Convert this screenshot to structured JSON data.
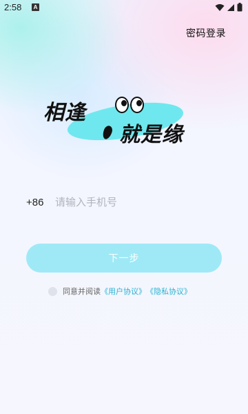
{
  "status_bar": {
    "time": "2:58",
    "notification_letter": "A",
    "icons": [
      "wifi-icon",
      "signal-icon",
      "battery-icon"
    ]
  },
  "header": {
    "password_login": "密码登录"
  },
  "logo": {
    "line1": "相逢",
    "line2": "就是缘",
    "accent_color": "#6ee8ee"
  },
  "phone": {
    "country_code": "+86",
    "placeholder": "请输入手机号",
    "value": ""
  },
  "next_button": {
    "label": "下一步",
    "color": "#9fe9f6"
  },
  "agreement": {
    "prefix": "同意并阅读",
    "user_agreement": "《用户协议》",
    "privacy_agreement": "《隐私协议》",
    "link_color": "#27b3d1"
  }
}
